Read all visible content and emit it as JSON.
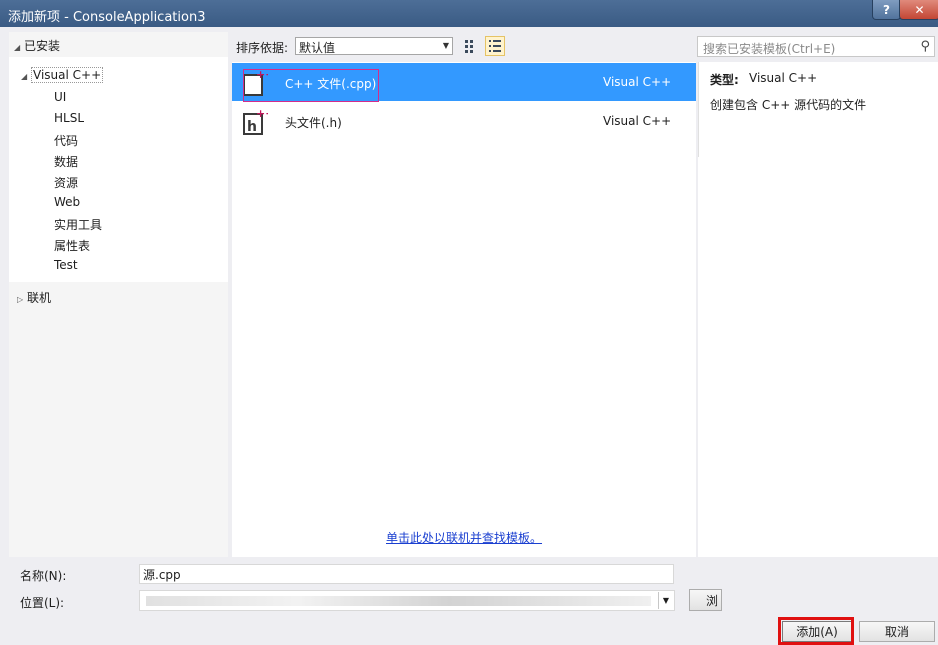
{
  "window": {
    "title": "添加新项 - ConsoleApplication3",
    "help_label": "?",
    "close_label": "✕"
  },
  "tree": {
    "installed_label": "已安装",
    "root_label": "Visual C++",
    "children": [
      "UI",
      "HLSL",
      "代码",
      "数据",
      "资源",
      "Web",
      "实用工具",
      "属性表",
      "Test"
    ],
    "online_label": "联机"
  },
  "toolbar": {
    "sort_label": "排序依据:",
    "sort_value": "默认值",
    "search_placeholder": "搜索已安装模板(Ctrl+E)"
  },
  "templates": [
    {
      "name": "C++ 文件(.cpp)",
      "type": "Visual C++",
      "selected": true
    },
    {
      "name": "头文件(.h)",
      "type": "Visual C++",
      "selected": false
    }
  ],
  "online_link": "单击此处以联机并查找模板。",
  "info": {
    "type_label": "类型:",
    "type_value": "Visual C++",
    "description": "创建包含 C++ 源代码的文件"
  },
  "form": {
    "name_label": "名称(N):",
    "name_value": "源.cpp",
    "location_label": "位置(L):",
    "browse_label": "浏",
    "add_label": "添加(A)",
    "cancel_label": "取消"
  },
  "colors": {
    "selection": "#3399ff",
    "link": "#1a3fd0",
    "highlight": "#e01010",
    "title_bar": "#3a5b84"
  }
}
